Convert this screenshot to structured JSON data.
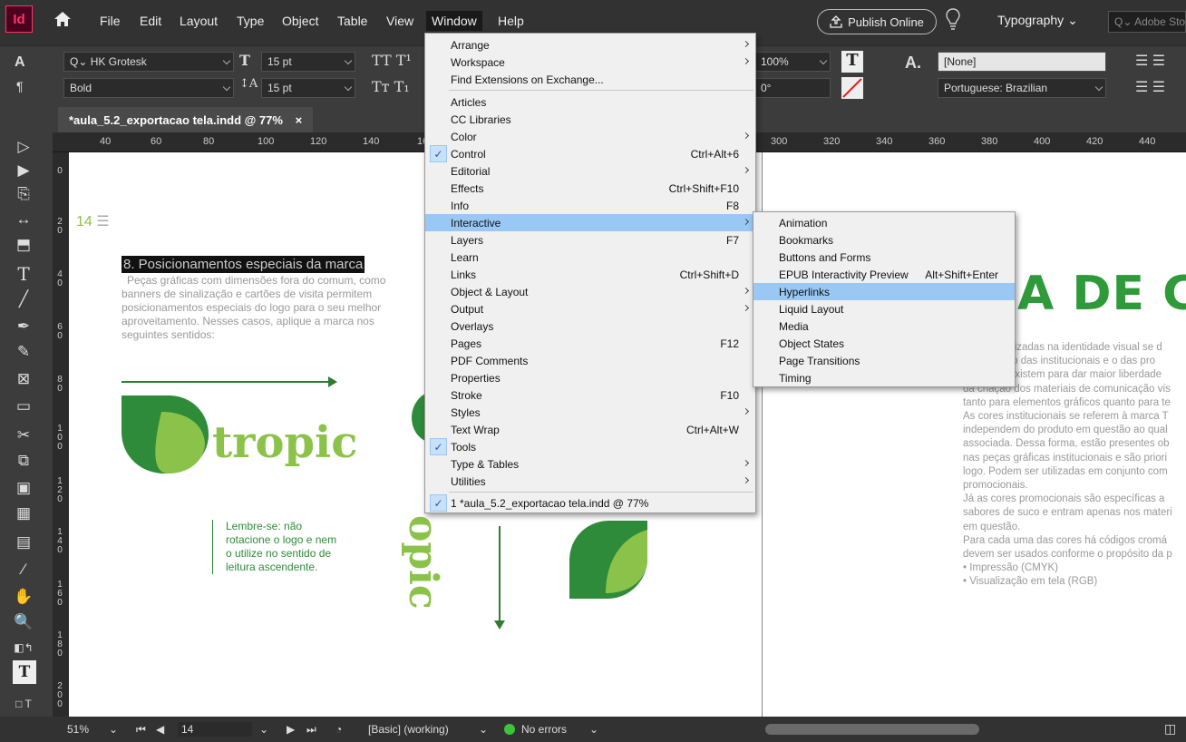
{
  "app": {
    "logo": "Id"
  },
  "menubar": {
    "items": [
      "File",
      "Edit",
      "Layout",
      "Type",
      "Object",
      "Table",
      "View",
      "Window",
      "Help"
    ],
    "publish_online": "Publish Online",
    "workspace": "Typography",
    "stock_search_placeholder": "Adobe Stock"
  },
  "control": {
    "font_family": "HK Grotesk",
    "font_style": "Bold",
    "font_size": "15 pt",
    "leading": "15 pt",
    "scale": "100%",
    "skew": "0°",
    "char_style": "[None]",
    "language": "Portuguese: Brazilian"
  },
  "tab": {
    "title": "*aula_5.2_exportacao tela.indd @ 77%",
    "close": "×"
  },
  "ruler": {
    "h_ticks": [
      "40",
      "60",
      "80",
      "100",
      "120",
      "140",
      "160",
      "300",
      "320",
      "340",
      "360",
      "380",
      "400",
      "420",
      "440"
    ],
    "v_ticks": [
      "0",
      "20",
      "40",
      "60",
      "80",
      "100",
      "120",
      "140",
      "160",
      "180",
      "200"
    ]
  },
  "window_menu": {
    "items": [
      {
        "label": "Arrange",
        "submenu": true
      },
      {
        "label": "Workspace",
        "submenu": true
      },
      {
        "label": "Find Extensions on Exchange...",
        "sep_after": true
      },
      {
        "label": "Articles"
      },
      {
        "label": "CC Libraries"
      },
      {
        "label": "Color",
        "submenu": true
      },
      {
        "label": "Control",
        "shortcut": "Ctrl+Alt+6",
        "checked": true
      },
      {
        "label": "Editorial",
        "submenu": true
      },
      {
        "label": "Effects",
        "shortcut": "Ctrl+Shift+F10"
      },
      {
        "label": "Info",
        "shortcut": "F8"
      },
      {
        "label": "Interactive",
        "submenu": true,
        "hover": true
      },
      {
        "label": "Layers",
        "shortcut": "F7"
      },
      {
        "label": "Learn"
      },
      {
        "label": "Links",
        "shortcut": "Ctrl+Shift+D"
      },
      {
        "label": "Object & Layout",
        "submenu": true
      },
      {
        "label": "Output",
        "submenu": true
      },
      {
        "label": "Overlays"
      },
      {
        "label": "Pages",
        "shortcut": "F12"
      },
      {
        "label": "PDF Comments"
      },
      {
        "label": "Properties"
      },
      {
        "label": "Stroke",
        "shortcut": "F10"
      },
      {
        "label": "Styles",
        "submenu": true
      },
      {
        "label": "Text Wrap",
        "shortcut": "Ctrl+Alt+W"
      },
      {
        "label": "Tools",
        "checked": true
      },
      {
        "label": "Type & Tables",
        "submenu": true
      },
      {
        "label": "Utilities",
        "submenu": true,
        "sep_after": true
      },
      {
        "label": "1 *aula_5.2_exportacao tela.indd @ 77%",
        "checked": true
      }
    ]
  },
  "interactive_menu": {
    "items": [
      {
        "label": "Animation"
      },
      {
        "label": "Bookmarks"
      },
      {
        "label": "Buttons and Forms"
      },
      {
        "label": "EPUB Interactivity Preview",
        "shortcut": "Alt+Shift+Enter"
      },
      {
        "label": "Hyperlinks",
        "hover": true
      },
      {
        "label": "Liquid Layout"
      },
      {
        "label": "Media"
      },
      {
        "label": "Object States"
      },
      {
        "label": "Page Transitions"
      },
      {
        "label": "Timing"
      }
    ]
  },
  "document": {
    "page_number": "14",
    "heading": "8. Posicionamentos especiais da marca",
    "intro": [
      "Peças gráficas com dimensões fora do comum, como",
      "banners de sinalização e cartões de visita permitem",
      "posicionamentos especiais do logo para o seu melhor",
      "aproveitamento. Nesses casos, aplique a marca nos",
      "seguintes sentidos:"
    ],
    "logo_word": "tropic",
    "logo_word_rotated": "opic",
    "note": [
      "Lembre-se: não",
      "rotacione o logo e nem",
      "o utilize no sentido de",
      "leitura ascendente."
    ],
    "right_heading": "A DE COI",
    "right_body": [
      "utilizadas na identidade visual se d",
      "s: o das institucionais e o das pro",
      "s existem para dar maior liberdade",
      "da criação dos materiais de comunicação vis",
      "tanto para elementos gráficos quanto para te",
      "  As cores institucionais se referem à marca T",
      "independem do produto em questão ao qual",
      "associada. Dessa forma, estão presentes ob",
      "nas peças gráficas institucionais e são priori",
      "logo. Podem ser utilizadas em conjunto com",
      "promocionais.",
      "  Já as cores promocionais são específicas a",
      "sabores de suco e entram apenas nos materi",
      "em questão.",
      "  Para cada uma das cores há códigos cromá",
      "devem ser usados conforme o propósito da p",
      "    • Impressão (CMYK)",
      "    • Visualização em tela (RGB)"
    ]
  },
  "status": {
    "zoom": "51%",
    "page": "14",
    "profile": "[Basic] (working)",
    "errors": "No errors"
  },
  "colors": {
    "accent_green": "#2E9A3A",
    "light_green": "#8BC34A",
    "menu_hover": "#99C8F5"
  }
}
